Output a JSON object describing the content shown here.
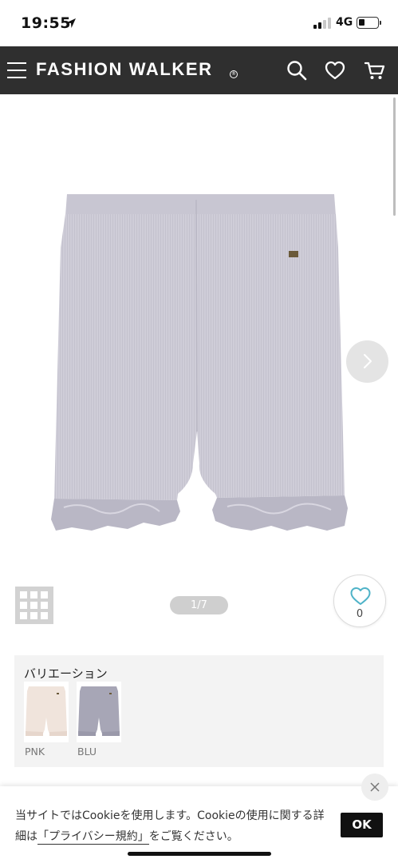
{
  "status_bar": {
    "time": "19:55",
    "network": "4G",
    "signal_bars_active": 2,
    "battery_level": 0.35
  },
  "header": {
    "logo_text": "FASHION WALKER",
    "logo_mark": "®",
    "background": "#2f2f2f",
    "icons": [
      "menu-icon",
      "search-icon",
      "heart-icon",
      "cart-icon"
    ]
  },
  "product": {
    "image_alt_icon": "shorts-product-image",
    "pager": "1/7",
    "favorite_count": "0",
    "favorite_color": "#4fb3c8"
  },
  "variation": {
    "title": "バリエーション",
    "items": [
      {
        "label": "PNK",
        "color": "#f0e4dc"
      },
      {
        "label": "BLU",
        "color": "#a7a6b6"
      }
    ]
  },
  "cookie": {
    "text_before": "当サイトではCookieを使用します。Cookieの使用に関する詳細は",
    "link_text": "「プライバシー規約」",
    "text_after": "をご覧ください。",
    "ok_label": "OK"
  }
}
